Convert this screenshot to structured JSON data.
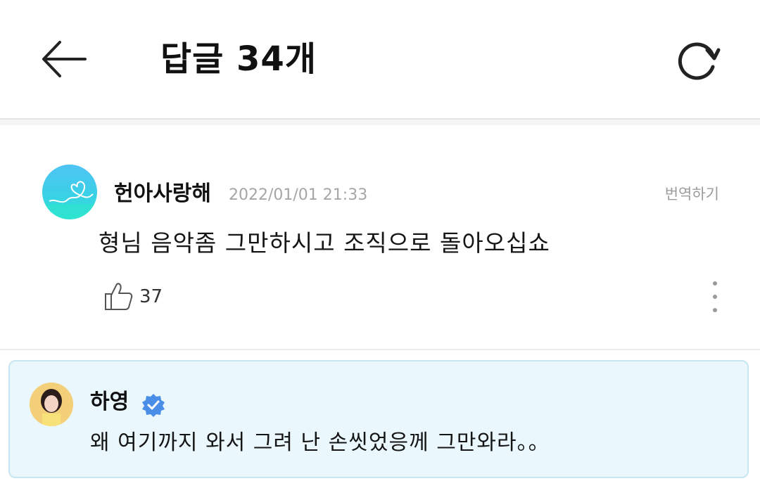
{
  "header": {
    "title": "답글 34개",
    "back_icon": "arrow-left-icon",
    "refresh_icon": "refresh-icon"
  },
  "comment": {
    "author": "헌아사랑해",
    "timestamp": "2022/01/01 21:33",
    "translate_label": "번역하기",
    "text": "형님 음악좀 그만하시고 조직으로 돌아오십쇼",
    "likes": "37",
    "like_icon": "thumbs-up-icon",
    "more_icon": "more-vertical-icon"
  },
  "reply": {
    "author": "하영",
    "verified_icon": "verified-badge-icon",
    "text": "왜 여기까지 와서 그려 난 손씻었응께 그만와라。。"
  },
  "colors": {
    "reply_bg": "#eaf7fd",
    "reply_border": "#c6e7f2",
    "verified": "#4a8ee8",
    "timestamp": "#a6a6a6"
  }
}
